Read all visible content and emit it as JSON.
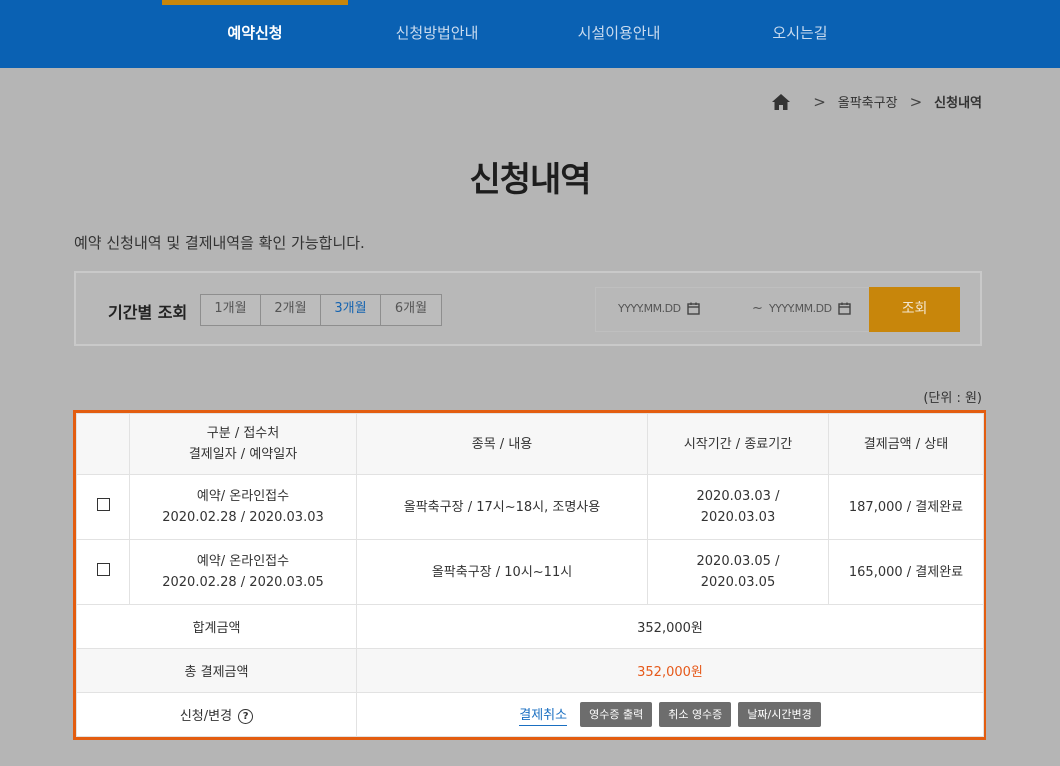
{
  "nav": {
    "items": [
      "예약신청",
      "신청방법안내",
      "시설이용안내",
      "오시는길"
    ]
  },
  "breadcrumb": {
    "home_icon": "home-icon",
    "items": [
      "올팍축구장",
      "신청내역"
    ]
  },
  "page": {
    "title": "신청내역",
    "description": "예약 신청내역 및 결제내역을 확인 가능합니다."
  },
  "search": {
    "label": "기간별 조회",
    "periods": [
      "1개월",
      "2개월",
      "3개월",
      "6개월"
    ],
    "active_period": "3개월",
    "start_placeholder": "YYYY.MM.DD",
    "end_placeholder": "YYYY.MM.DD",
    "tilde": "~",
    "button": "조회",
    "calendar_icon": "calendar-icon"
  },
  "unit": "(단위 : 원)",
  "table": {
    "headers": {
      "category_line1": "구분 / 접수처",
      "category_line2": "결제일자 / 예약일자",
      "item": "종목 / 내용",
      "period": "시작기간 / 종료기간",
      "amount": "결제금액 / 상태"
    },
    "rows": [
      {
        "category": "예약/ 온라인접수",
        "dates": "2020.02.28 / 2020.03.03",
        "item": "올팍축구장 / 17시~18시, 조명사용",
        "start": "2020.03.03 /",
        "end": "2020.03.03",
        "amount": "187,000 / 결제완료"
      },
      {
        "category": "예약/ 온라인접수",
        "dates": "2020.02.28 / 2020.03.05",
        "item": "올팍축구장 / 10시~11시",
        "start": "2020.03.05 /",
        "end": "2020.03.05",
        "amount": "165,000 / 결제완료"
      }
    ],
    "subtotal": {
      "label": "합계금액",
      "value": "352,000원"
    },
    "total": {
      "label": "총 결제금액",
      "value": "352,000원"
    },
    "actions": {
      "label": "신청/변경",
      "help": "?",
      "cancel_payment": "결제취소",
      "print_receipt": "영수증 출력",
      "cancel_receipt": "취소 영수증",
      "change_datetime": "날짜/시간변경"
    }
  },
  "colors": {
    "nav_bg": "#0a61b3",
    "accent": "#c8860b",
    "highlight_border": "#e35d10",
    "price_red": "#e65a1b",
    "link_blue": "#1a6fc1"
  }
}
